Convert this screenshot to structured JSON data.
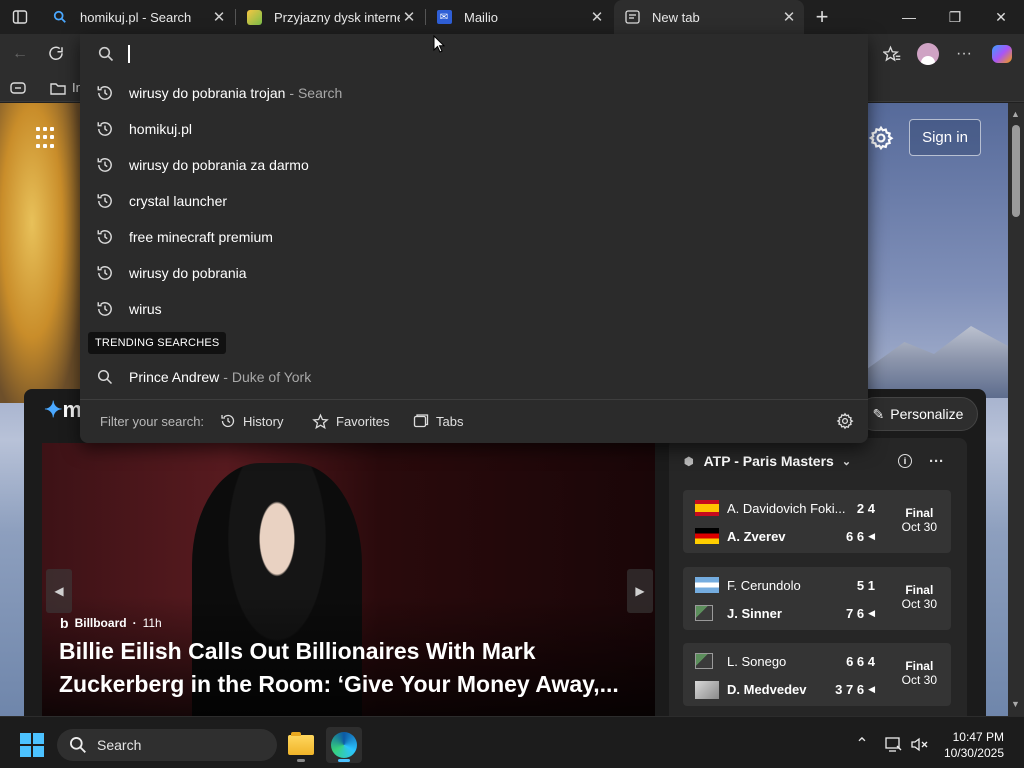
{
  "tabs": [
    {
      "title": "homikuj.pl - Search",
      "icon": "bing-search-icon",
      "active": false
    },
    {
      "title": "Przyjazny dysk internetowy",
      "icon": "drive-icon",
      "active": false
    },
    {
      "title": "Mailio",
      "icon": "mail-icon",
      "active": false
    },
    {
      "title": "New tab",
      "icon": "newtab-icon",
      "active": true
    }
  ],
  "address": {
    "value": "",
    "suggestions": [
      {
        "text": "wirusy do pobrania trojan",
        "suffix": "- Search",
        "icon": "history-icon"
      },
      {
        "text": "homikuj.pl",
        "suffix": "",
        "icon": "history-icon"
      },
      {
        "text": "wirusy do pobrania za darmo",
        "suffix": "",
        "icon": "history-icon"
      },
      {
        "text": "crystal launcher",
        "suffix": "",
        "icon": "history-icon"
      },
      {
        "text": "free minecraft premium",
        "suffix": "",
        "icon": "history-icon"
      },
      {
        "text": "wirusy do pobrania",
        "suffix": "",
        "icon": "history-icon"
      },
      {
        "text": "wirus",
        "suffix": "",
        "icon": "history-icon"
      }
    ],
    "trending_label": "TRENDING SEARCHES",
    "trending": [
      {
        "text": "Prince Andrew",
        "suffix": "- Duke of York",
        "icon": "search-icon"
      }
    ],
    "filter_label": "Filter your search:",
    "filters": [
      "History",
      "Favorites",
      "Tabs"
    ]
  },
  "favorites_bar": {
    "item_fragment": "In"
  },
  "newtab": {
    "signin_label": "Sign in",
    "personalize_label": "Personalize",
    "feed_logo_fragment": "m"
  },
  "hero": {
    "source": "Billboard",
    "age": "11h",
    "headline": "Billie Eilish Calls Out Billionaires With Mark Zuckerberg in the Room: ‘Give Your Money Away,..."
  },
  "sports": {
    "title": "ATP - Paris Masters",
    "matches": [
      {
        "p1": "A. Davidovich Foki...",
        "s1": "2 4",
        "p2": "A. Zverev",
        "s2": "6 6",
        "winner": 2,
        "status": "Final",
        "date": "Oct 30",
        "flag1": "spain",
        "flag2": "germany"
      },
      {
        "p1": "F. Cerundolo",
        "s1": "5 1",
        "p2": "J. Sinner",
        "s2": "7 6",
        "winner": 2,
        "status": "Final",
        "date": "Oct 30",
        "flag1": "argentina",
        "flag2": "broken-image"
      },
      {
        "p1": "L. Sonego",
        "s1": "6 6 4",
        "p2": "D. Medvedev",
        "s2": "3 7 6",
        "winner": 2,
        "status": "Final",
        "date": "Oct 30",
        "flag1": "broken-image",
        "flag2": "placeholder"
      }
    ]
  },
  "taskbar": {
    "search_label": "Search",
    "time": "10:47 PM",
    "date": "10/30/2025"
  },
  "colors": {
    "accent": "#4cc2ff",
    "tab_active": "#2d2d2d",
    "omnibox": "#2b2b2b"
  }
}
